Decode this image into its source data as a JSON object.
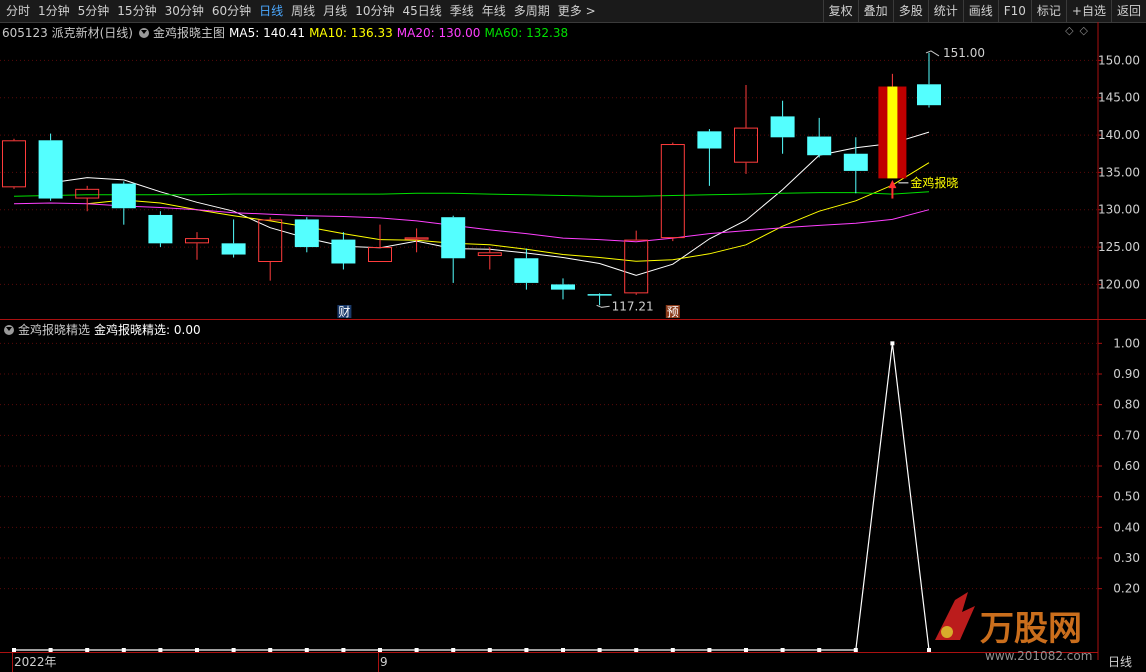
{
  "toolbar": {
    "periods": [
      "分时",
      "1分钟",
      "5分钟",
      "15分钟",
      "30分钟",
      "60分钟",
      "日线",
      "周线",
      "月线",
      "10分钟",
      "45日线",
      "季线",
      "年线",
      "多周期",
      "更多 >"
    ],
    "active_period": "日线",
    "buttons": [
      "复权",
      "叠加",
      "多股",
      "统计",
      "画线",
      "F10",
      "标记",
      "+自选",
      "返回"
    ]
  },
  "main_header": {
    "code_name": "605123 派克新材(日线)",
    "indicator": "金鸡报晓主图",
    "ma5": "MA5: 140.41",
    "ma10": "MA10: 136.33",
    "ma20": "MA20: 130.00",
    "ma60": "MA60: 132.38",
    "colors": {
      "ma5": "#ffffff",
      "ma10": "#ffff00",
      "ma20": "#ff40ff",
      "ma60": "#00e000"
    }
  },
  "sub_header": {
    "indicator": "金鸡报晓精选",
    "value": "金鸡报晓精选: 0.00"
  },
  "annotations": {
    "high_label": "151.00",
    "low_label": "117.21",
    "signal_label": "金鸡报晓",
    "fin_marker": "财",
    "pre_marker": "预"
  },
  "bottom": {
    "year": "2022年",
    "month": "9",
    "period": "日线"
  },
  "watermark": {
    "text": "万股网",
    "url": "www.201082.com"
  },
  "chart_data": [
    {
      "type": "candlestick",
      "title": "605123 派克新材(日线)",
      "ylim": [
        115.5,
        153
      ],
      "y_ticks": [
        120.0,
        125.0,
        130.0,
        135.0,
        140.0,
        145.0,
        150.0
      ],
      "candles": [
        {
          "o": 133.0,
          "c": 139.3,
          "h": 139.5,
          "l": 132.8
        },
        {
          "o": 139.3,
          "c": 131.5,
          "h": 140.2,
          "l": 131.2
        },
        {
          "o": 131.5,
          "c": 132.8,
          "h": 133.2,
          "l": 129.8
        },
        {
          "o": 133.5,
          "c": 130.2,
          "h": 133.8,
          "l": 128.0
        },
        {
          "o": 129.3,
          "c": 125.5,
          "h": 129.8,
          "l": 125.0
        },
        {
          "o": 125.5,
          "c": 126.2,
          "h": 127.0,
          "l": 123.3
        },
        {
          "o": 125.5,
          "c": 124.0,
          "h": 128.7,
          "l": 123.6
        },
        {
          "o": 123.0,
          "c": 128.7,
          "h": 129.0,
          "l": 120.5
        },
        {
          "o": 128.7,
          "c": 125.0,
          "h": 129.0,
          "l": 124.3
        },
        {
          "o": 126.0,
          "c": 122.8,
          "h": 127.0,
          "l": 122.0
        },
        {
          "o": 123.0,
          "c": 125.0,
          "h": 128.0,
          "l": 123.0
        },
        {
          "o": 126.0,
          "c": 126.3,
          "h": 127.5,
          "l": 124.3
        },
        {
          "o": 129.0,
          "c": 123.5,
          "h": 129.2,
          "l": 120.2
        },
        {
          "o": 123.8,
          "c": 124.3,
          "h": 125.0,
          "l": 122.0
        },
        {
          "o": 123.5,
          "c": 120.2,
          "h": 124.8,
          "l": 119.3
        },
        {
          "o": 120.0,
          "c": 119.3,
          "h": 120.8,
          "l": 118.0
        },
        {
          "o": 118.7,
          "c": 118.5,
          "h": 118.8,
          "l": 117.2
        },
        {
          "o": 118.8,
          "c": 126.0,
          "h": 127.2,
          "l": 118.6
        },
        {
          "o": 126.2,
          "c": 138.8,
          "h": 139.0,
          "l": 125.8
        },
        {
          "o": 140.5,
          "c": 138.2,
          "h": 140.8,
          "l": 133.2
        },
        {
          "o": 136.3,
          "c": 141.0,
          "h": 146.7,
          "l": 134.8
        },
        {
          "o": 142.5,
          "c": 139.7,
          "h": 144.6,
          "l": 137.5
        },
        {
          "o": 139.8,
          "c": 137.3,
          "h": 142.3,
          "l": 137.0
        },
        {
          "o": 137.5,
          "c": 135.2,
          "h": 139.7,
          "l": 132.2
        },
        {
          "o": 134.2,
          "c": 146.5,
          "h": 148.2,
          "l": 134.2
        },
        {
          "o": 146.8,
          "c": 144.0,
          "h": 151.0,
          "l": 143.7
        }
      ],
      "series": [
        {
          "name": "MA5",
          "values": [
            null,
            133.6,
            134.3,
            134.0,
            132.4,
            131.0,
            129.8,
            127.6,
            126.2,
            125.1,
            124.9,
            125.8,
            124.8,
            124.7,
            124.2,
            123.6,
            122.8,
            121.2,
            122.7,
            126.1,
            128.6,
            132.7,
            137.3,
            138.3,
            138.9,
            140.4
          ]
        },
        {
          "name": "MA10",
          "values": [
            null,
            null,
            130.8,
            131.3,
            130.9,
            130.0,
            129.2,
            128.5,
            127.7,
            126.8,
            126.0,
            125.9,
            125.5,
            125.3,
            124.7,
            124.0,
            123.6,
            123.1,
            123.3,
            124.1,
            125.3,
            127.8,
            129.8,
            131.2,
            133.3,
            136.3
          ]
        },
        {
          "name": "MA20",
          "values": [
            130.8,
            130.9,
            130.8,
            130.5,
            130.3,
            130.0,
            129.6,
            129.4,
            129.2,
            129.1,
            128.9,
            128.5,
            127.9,
            127.3,
            126.8,
            126.2,
            126.0,
            125.7,
            126.2,
            126.8,
            127.2,
            127.6,
            127.9,
            128.2,
            128.7,
            130.0
          ]
        },
        {
          "name": "MA60",
          "values": [
            131.8,
            131.9,
            132.0,
            132.0,
            132.0,
            132.0,
            132.1,
            132.1,
            132.1,
            132.1,
            132.1,
            132.2,
            132.2,
            132.1,
            132.0,
            131.9,
            131.8,
            131.8,
            131.9,
            132.0,
            132.1,
            132.2,
            132.3,
            132.3,
            132.1,
            132.4
          ]
        }
      ]
    },
    {
      "type": "line",
      "title": "金鸡报晓精选",
      "ylim": [
        0,
        1.05
      ],
      "y_ticks": [
        0.2,
        0.3,
        0.4,
        0.5,
        0.6,
        0.7,
        0.8,
        0.9,
        1.0
      ],
      "values": [
        0,
        0,
        0,
        0,
        0,
        0,
        0,
        0,
        0,
        0,
        0,
        0,
        0,
        0,
        0,
        0,
        0,
        0,
        0,
        0,
        0,
        0,
        0,
        0,
        1,
        0
      ]
    }
  ]
}
